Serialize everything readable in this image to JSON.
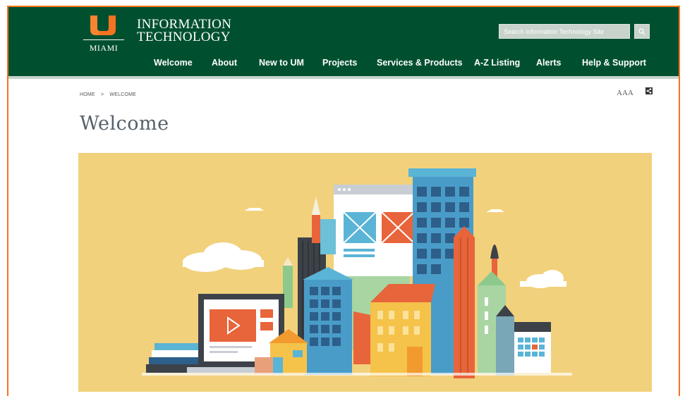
{
  "site": {
    "brand_mark": "MIAMI",
    "title_line1": "INFORMATION",
    "title_line2": "TECHNOLOGY"
  },
  "search": {
    "placeholder": "Search Information Technology Site"
  },
  "nav": {
    "items": [
      "Welcome",
      "About",
      "New to UM",
      "Projects",
      "Services & Products",
      "A-Z Listing",
      "Alerts",
      "Help & Support"
    ]
  },
  "breadcrumb": {
    "home": "HOME",
    "separator": ">",
    "current": "WELCOME"
  },
  "tools": {
    "text_size_label": "AAA"
  },
  "page": {
    "title": "Welcome"
  },
  "colors": {
    "header_green": "#005030",
    "accent_orange": "#f47321",
    "hero_yellow": "#f2d17c"
  },
  "icons": {
    "search": "search-icon",
    "share": "share-icon",
    "logo": "u-logo-icon"
  }
}
